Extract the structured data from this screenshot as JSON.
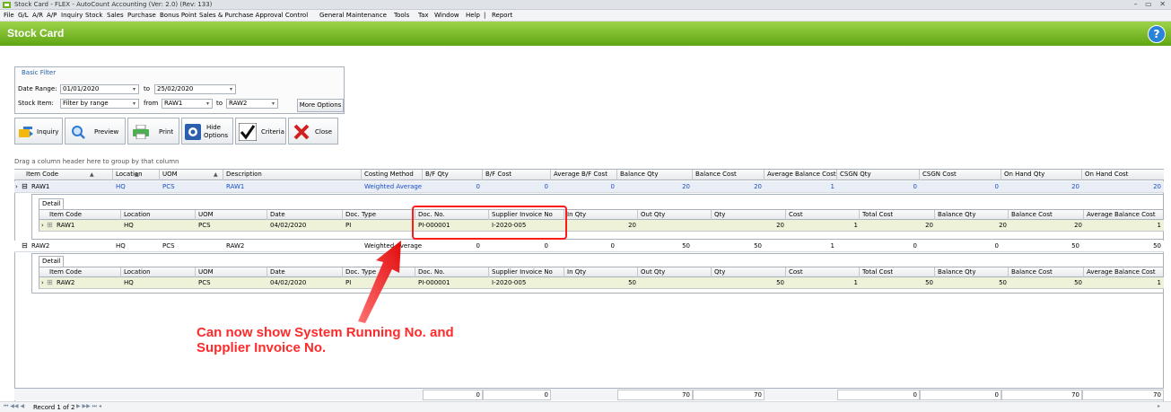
{
  "window": {
    "title": "Stock Card - FLEX - AutoCount Accounting (Ver: 2.0) (Rev: 133)",
    "controls": "– ▭ ✕"
  },
  "menu": [
    "File",
    "G/L",
    "A/R",
    "A/P",
    "Inquiry",
    "Stock",
    "Sales",
    "Purchase",
    "Bonus Point",
    "Sales & Purchase Approval Control",
    "General Maintenance",
    "Tools",
    "Tax",
    "Window",
    "Help",
    "|",
    "Report"
  ],
  "header": {
    "title": "Stock Card",
    "help": "?"
  },
  "filter": {
    "title": "Basic Filter",
    "date_range_label": "Date Range:",
    "date_from": "01/01/2020",
    "to_label": "to",
    "date_to": "25/02/2020",
    "stock_item_label": "Stock Item:",
    "stock_mode": "Filter by range",
    "from_label": "from",
    "item_from": "RAW1",
    "item_to": "RAW2",
    "more_options": "More Options"
  },
  "toolbar": {
    "inquiry": "Inquiry",
    "preview": "Preview",
    "print": "Print",
    "hide1": "Hide",
    "hide2": "Options",
    "criteria": "Criteria",
    "close": "Close"
  },
  "grid": {
    "group_hint": "Drag a column header here to group by that column",
    "headers": [
      "Item Code",
      "Location",
      "UOM",
      "Description",
      "Costing Method",
      "B/F Qty",
      "B/F Cost",
      "Average B/F Cost",
      "Balance Qty",
      "Balance Cost",
      "Average Balance Cost",
      "CSGN Qty",
      "CSGN Cost",
      "On Hand Qty",
      "On Hand Cost"
    ],
    "rows": [
      {
        "item": "RAW1",
        "location": "HQ",
        "uom": "PCS",
        "desc": "RAW1",
        "method": "Weighted Average",
        "bf_qty": "0",
        "bf_cost": "0",
        "avg_bf": "0",
        "bal_qty": "20",
        "bal_cost": "20",
        "avg_bal": "1",
        "csgn_qty": "0",
        "csgn_cost": "0",
        "oh_qty": "20",
        "oh_cost": "20"
      },
      {
        "item": "RAW2",
        "location": "HQ",
        "uom": "PCS",
        "desc": "RAW2",
        "method": "Weighted Average",
        "bf_qty": "0",
        "bf_cost": "0",
        "avg_bf": "0",
        "bal_qty": "50",
        "bal_cost": "50",
        "avg_bal": "1",
        "csgn_qty": "0",
        "csgn_cost": "0",
        "oh_qty": "50",
        "oh_cost": "50"
      }
    ],
    "detail_tab": "Detail",
    "detail_headers": [
      "Item Code",
      "Location",
      "UOM",
      "Date",
      "Doc. Type",
      "Doc. No.",
      "Supplier Invoice No",
      "In Qty",
      "Out Qty",
      "Qty",
      "Cost",
      "Total Cost",
      "Balance Qty",
      "Balance Cost",
      "Average Balance Cost"
    ],
    "details": [
      {
        "item": "RAW1",
        "location": "HQ",
        "uom": "PCS",
        "date": "04/02/2020",
        "doc_type": "PI",
        "doc_no": "PI-000001",
        "sup_inv": "I-2020-005",
        "in_qty": "20",
        "out_qty": "",
        "qty": "20",
        "cost": "1",
        "total": "20",
        "bal_qty": "20",
        "bal_cost": "20",
        "avg": "1"
      },
      {
        "item": "RAW2",
        "location": "HQ",
        "uom": "PCS",
        "date": "04/02/2020",
        "doc_type": "PI",
        "doc_no": "PI-000001",
        "sup_inv": "I-2020-005",
        "in_qty": "50",
        "out_qty": "",
        "qty": "50",
        "cost": "1",
        "total": "50",
        "bal_qty": "50",
        "bal_cost": "50",
        "avg": "1"
      }
    ],
    "footer": {
      "bf_qty": "0",
      "bf_cost": "0",
      "bal_qty": "70",
      "bal_cost": "70",
      "csgn_qty": "0",
      "csgn_cost": "0",
      "oh_qty": "70",
      "oh_cost": "70"
    }
  },
  "annotation": {
    "line1": "Can now show System Running No. and",
    "line2": "Supplier Invoice No."
  },
  "status": {
    "record": "Record 1 of 2"
  },
  "colors": {
    "header_green": "#6fb31c",
    "annotation_red": "#ff2a2a",
    "link_blue": "#1c4ec9"
  }
}
